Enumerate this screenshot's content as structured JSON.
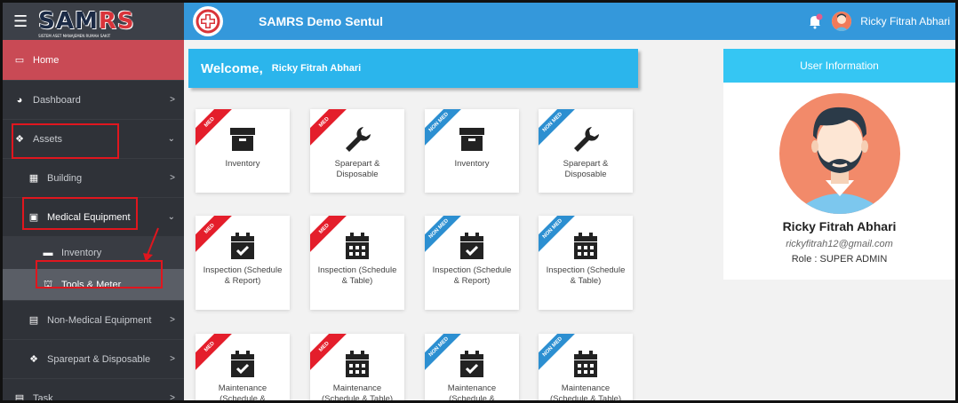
{
  "brand": {
    "logo_main": "SAM",
    "logo_accent": "RS",
    "logo_sub": "SISTEM ASET MANAJEMEN RUMAH SAKIT"
  },
  "header": {
    "title": "SAMRS Demo Sentul",
    "user_name": "Ricky Fitrah Abhari"
  },
  "sidebar": {
    "items": [
      {
        "label": "Home",
        "icon": "laptop-icon",
        "glyph": "▭"
      },
      {
        "label": "Dashboard",
        "icon": "palette-icon",
        "glyph": "◕"
      },
      {
        "label": "Assets",
        "icon": "cubes-icon",
        "glyph": "❖"
      },
      {
        "label": "Building",
        "icon": "building-icon",
        "glyph": "▦"
      },
      {
        "label": "Medical Equipment",
        "icon": "medkit-icon",
        "glyph": "▣"
      },
      {
        "label": "Inventory",
        "icon": "archive-icon",
        "glyph": "▬"
      },
      {
        "label": "Tools & Meter",
        "icon": "toolbox-icon",
        "glyph": "⛫"
      },
      {
        "label": "Non-Medical Equipment",
        "icon": "clipboard-icon",
        "glyph": "▤"
      },
      {
        "label": "Sparepart & Disposable",
        "icon": "cubes-icon",
        "glyph": "❖"
      },
      {
        "label": "Task",
        "icon": "clipboard-icon",
        "glyph": "▤"
      }
    ]
  },
  "welcome": {
    "greeting": "Welcome,",
    "name": "Ricky Fitrah Abhari"
  },
  "ribbons": {
    "med": "MED",
    "nonmed": "NON MED"
  },
  "tiles": [
    {
      "label": "Inventory",
      "ribbon": "med"
    },
    {
      "label": "Sparepart & Disposable",
      "ribbon": "med"
    },
    {
      "label": "Inventory",
      "ribbon": "nonmed"
    },
    {
      "label": "Sparepart & Disposable",
      "ribbon": "nonmed"
    },
    {
      "label": "Inspection (Schedule & Report)",
      "ribbon": "med"
    },
    {
      "label": "Inspection (Schedule & Table)",
      "ribbon": "med"
    },
    {
      "label": "Inspection (Schedule & Report)",
      "ribbon": "nonmed"
    },
    {
      "label": "Inspection (Schedule & Table)",
      "ribbon": "nonmed"
    },
    {
      "label": "Maintenance (Schedule &",
      "ribbon": "med"
    },
    {
      "label": "Maintenance (Schedule & Table)",
      "ribbon": "med"
    },
    {
      "label": "Maintenance (Schedule &",
      "ribbon": "nonmed"
    },
    {
      "label": "Maintenance (Schedule & Table)",
      "ribbon": "nonmed"
    }
  ],
  "user_info": {
    "title": "User Information",
    "name": "Ricky Fitrah Abhari",
    "email": "rickyfitrah12@gmail.com",
    "role": "Role : SUPER ADMIN"
  },
  "colors": {
    "header": "#3498db",
    "welcome": "#2bb5ec",
    "home": "#c94a55",
    "med_ribbon": "#e41e2b",
    "nonmed_ribbon": "#2c8fd1"
  }
}
